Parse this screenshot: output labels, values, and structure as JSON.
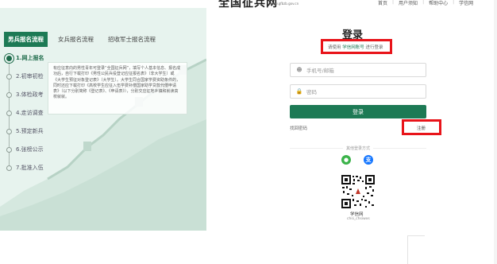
{
  "header": {
    "site_title": "全国征兵网",
    "site_url": "www.gfbzb.gov.cn",
    "nav": [
      "首页",
      "用户须知",
      "帮助中心",
      "学信网"
    ]
  },
  "tabs": [
    {
      "label": "男兵报名流程",
      "active": true
    },
    {
      "label": "女兵报名流程",
      "active": false
    },
    {
      "label": "招收军士报名流程",
      "active": false
    }
  ],
  "steps": [
    {
      "label": "1.网上报名",
      "active": true
    },
    {
      "label": "2.初审初检",
      "active": false
    },
    {
      "label": "3.体检政考",
      "active": false
    },
    {
      "label": "4.走访调查",
      "active": false
    },
    {
      "label": "5.预定新兵",
      "active": false
    },
    {
      "label": "6.张榜公示",
      "active": false
    },
    {
      "label": "7.批准入伍",
      "active": false
    }
  ],
  "info_text": "有应征意向的男性青年可登录“全国征兵网”，填写个人基本信息、报名成功后，自行下载打印《男性公民兵役登记应征报名表》（非大学生）或《大学生预征对象登记表》（大学生）。大学生同合国家学费资助条件的，同时还应下载打印《高校学生应征入伍学费补偿国家助学贷款代偿申请表》（以下分别简称《登记表》、《申请表》），分别交应征地乡镇和就读高校就就。",
  "login": {
    "title": "登录",
    "subtitle_pre": "请使用",
    "subtitle_highlight": "学信网账号",
    "subtitle_post": "进行登录",
    "phone_placeholder": "手机号/邮箱",
    "password_placeholder": "密码",
    "login_button": "登录",
    "forgot_link": "找回密码",
    "register_link": "注册",
    "other_methods": "其他登录方式",
    "wechat_icon": "wechat-icon",
    "alipay_icon": "alipay-icon",
    "qr_name": "学信网",
    "qr_id": "chsi_chsiwxs"
  },
  "colors": {
    "brand_green": "#1d7a55",
    "panel_bg": "#e7f3ee",
    "highlight_red": "#e8141a",
    "wechat_green": "#3bb34a",
    "alipay_blue": "#1677ff"
  }
}
